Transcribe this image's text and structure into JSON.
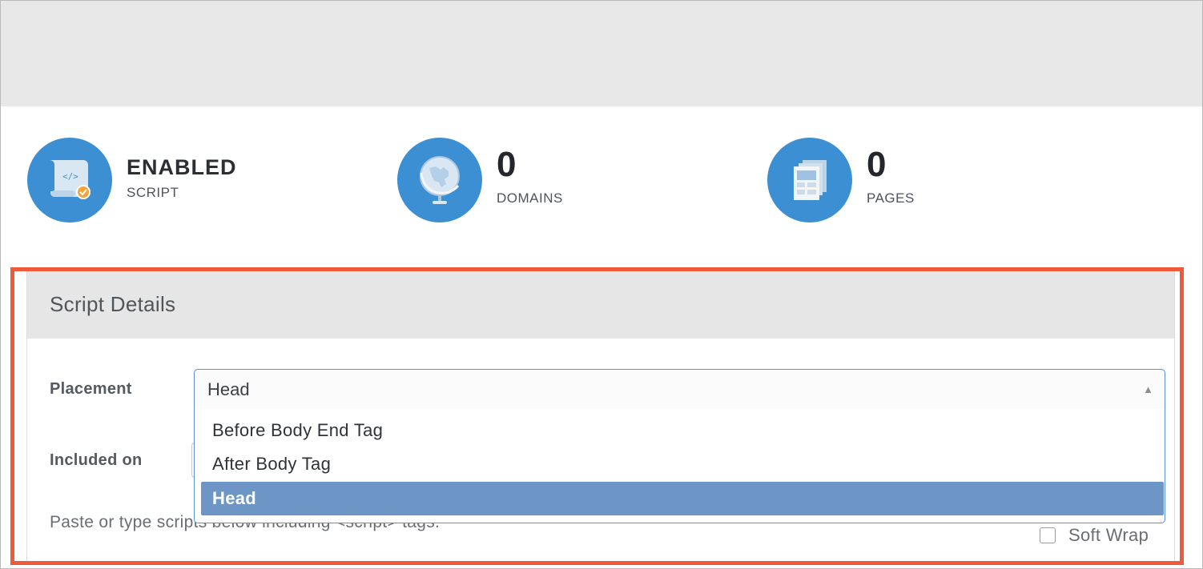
{
  "stats": [
    {
      "value": "ENABLED",
      "label": "SCRIPT",
      "icon": "script-scroll-icon"
    },
    {
      "value": "0",
      "label": "DOMAINS",
      "icon": "globe-icon"
    },
    {
      "value": "0",
      "label": "PAGES",
      "icon": "pages-icon"
    }
  ],
  "panel": {
    "title": "Script Details",
    "placement_label": "Placement",
    "included_label": "Included on",
    "placement_value": "Head",
    "options": [
      "Before Body End Tag",
      "After Body Tag",
      "Head"
    ],
    "hint": "Paste or type scripts below including <script> tags.",
    "soft_wrap_label": "Soft Wrap"
  },
  "colors": {
    "icon_circle": "#3c8fd2",
    "highlight": "#ee5a3b",
    "selected_option": "#6d96c6"
  }
}
